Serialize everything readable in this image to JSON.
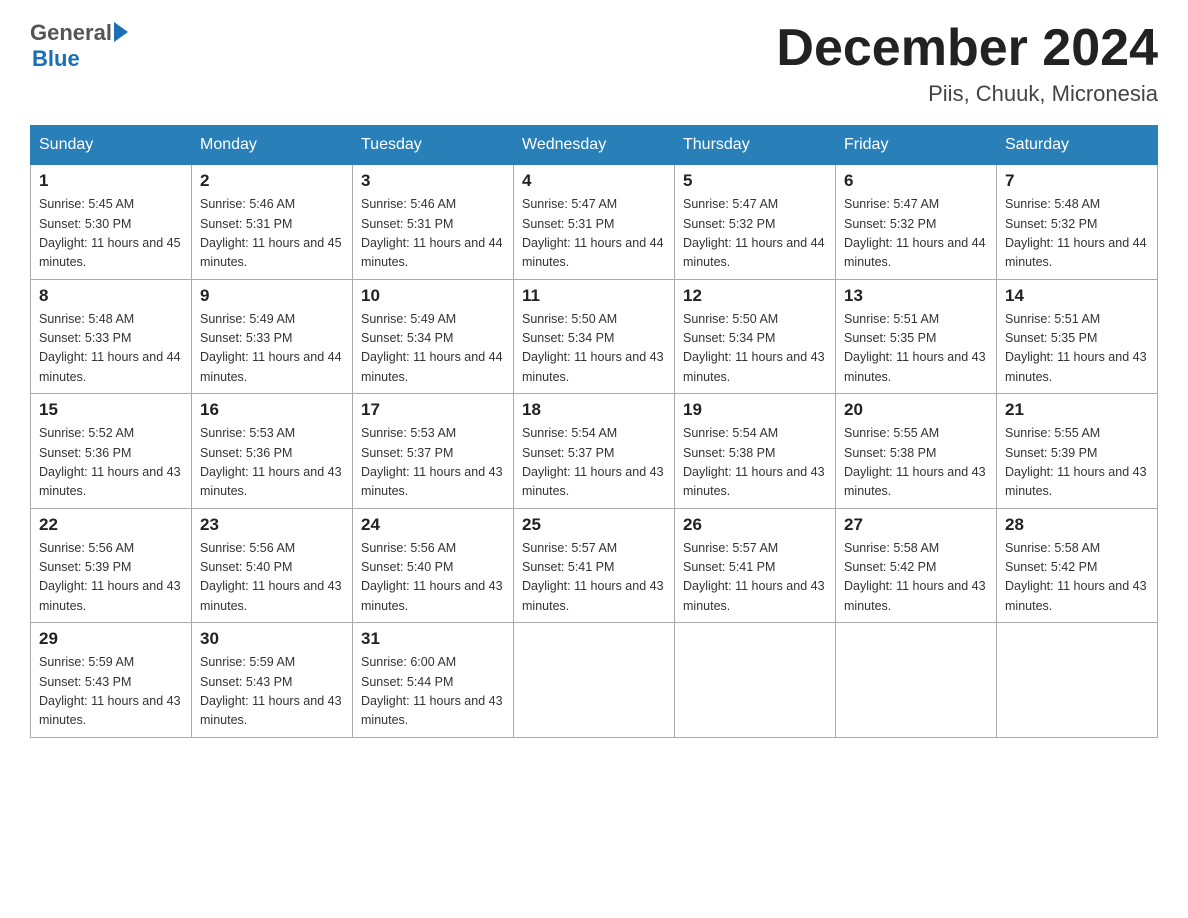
{
  "header": {
    "logo": {
      "general": "General",
      "blue": "Blue"
    },
    "title": "December 2024",
    "location": "Piis, Chuuk, Micronesia"
  },
  "days_of_week": [
    "Sunday",
    "Monday",
    "Tuesday",
    "Wednesday",
    "Thursday",
    "Friday",
    "Saturday"
  ],
  "weeks": [
    [
      {
        "day": "1",
        "sunrise": "5:45 AM",
        "sunset": "5:30 PM",
        "daylight": "11 hours and 45 minutes."
      },
      {
        "day": "2",
        "sunrise": "5:46 AM",
        "sunset": "5:31 PM",
        "daylight": "11 hours and 45 minutes."
      },
      {
        "day": "3",
        "sunrise": "5:46 AM",
        "sunset": "5:31 PM",
        "daylight": "11 hours and 44 minutes."
      },
      {
        "day": "4",
        "sunrise": "5:47 AM",
        "sunset": "5:31 PM",
        "daylight": "11 hours and 44 minutes."
      },
      {
        "day": "5",
        "sunrise": "5:47 AM",
        "sunset": "5:32 PM",
        "daylight": "11 hours and 44 minutes."
      },
      {
        "day": "6",
        "sunrise": "5:47 AM",
        "sunset": "5:32 PM",
        "daylight": "11 hours and 44 minutes."
      },
      {
        "day": "7",
        "sunrise": "5:48 AM",
        "sunset": "5:32 PM",
        "daylight": "11 hours and 44 minutes."
      }
    ],
    [
      {
        "day": "8",
        "sunrise": "5:48 AM",
        "sunset": "5:33 PM",
        "daylight": "11 hours and 44 minutes."
      },
      {
        "day": "9",
        "sunrise": "5:49 AM",
        "sunset": "5:33 PM",
        "daylight": "11 hours and 44 minutes."
      },
      {
        "day": "10",
        "sunrise": "5:49 AM",
        "sunset": "5:34 PM",
        "daylight": "11 hours and 44 minutes."
      },
      {
        "day": "11",
        "sunrise": "5:50 AM",
        "sunset": "5:34 PM",
        "daylight": "11 hours and 43 minutes."
      },
      {
        "day": "12",
        "sunrise": "5:50 AM",
        "sunset": "5:34 PM",
        "daylight": "11 hours and 43 minutes."
      },
      {
        "day": "13",
        "sunrise": "5:51 AM",
        "sunset": "5:35 PM",
        "daylight": "11 hours and 43 minutes."
      },
      {
        "day": "14",
        "sunrise": "5:51 AM",
        "sunset": "5:35 PM",
        "daylight": "11 hours and 43 minutes."
      }
    ],
    [
      {
        "day": "15",
        "sunrise": "5:52 AM",
        "sunset": "5:36 PM",
        "daylight": "11 hours and 43 minutes."
      },
      {
        "day": "16",
        "sunrise": "5:53 AM",
        "sunset": "5:36 PM",
        "daylight": "11 hours and 43 minutes."
      },
      {
        "day": "17",
        "sunrise": "5:53 AM",
        "sunset": "5:37 PM",
        "daylight": "11 hours and 43 minutes."
      },
      {
        "day": "18",
        "sunrise": "5:54 AM",
        "sunset": "5:37 PM",
        "daylight": "11 hours and 43 minutes."
      },
      {
        "day": "19",
        "sunrise": "5:54 AM",
        "sunset": "5:38 PM",
        "daylight": "11 hours and 43 minutes."
      },
      {
        "day": "20",
        "sunrise": "5:55 AM",
        "sunset": "5:38 PM",
        "daylight": "11 hours and 43 minutes."
      },
      {
        "day": "21",
        "sunrise": "5:55 AM",
        "sunset": "5:39 PM",
        "daylight": "11 hours and 43 minutes."
      }
    ],
    [
      {
        "day": "22",
        "sunrise": "5:56 AM",
        "sunset": "5:39 PM",
        "daylight": "11 hours and 43 minutes."
      },
      {
        "day": "23",
        "sunrise": "5:56 AM",
        "sunset": "5:40 PM",
        "daylight": "11 hours and 43 minutes."
      },
      {
        "day": "24",
        "sunrise": "5:56 AM",
        "sunset": "5:40 PM",
        "daylight": "11 hours and 43 minutes."
      },
      {
        "day": "25",
        "sunrise": "5:57 AM",
        "sunset": "5:41 PM",
        "daylight": "11 hours and 43 minutes."
      },
      {
        "day": "26",
        "sunrise": "5:57 AM",
        "sunset": "5:41 PM",
        "daylight": "11 hours and 43 minutes."
      },
      {
        "day": "27",
        "sunrise": "5:58 AM",
        "sunset": "5:42 PM",
        "daylight": "11 hours and 43 minutes."
      },
      {
        "day": "28",
        "sunrise": "5:58 AM",
        "sunset": "5:42 PM",
        "daylight": "11 hours and 43 minutes."
      }
    ],
    [
      {
        "day": "29",
        "sunrise": "5:59 AM",
        "sunset": "5:43 PM",
        "daylight": "11 hours and 43 minutes."
      },
      {
        "day": "30",
        "sunrise": "5:59 AM",
        "sunset": "5:43 PM",
        "daylight": "11 hours and 43 minutes."
      },
      {
        "day": "31",
        "sunrise": "6:00 AM",
        "sunset": "5:44 PM",
        "daylight": "11 hours and 43 minutes."
      },
      null,
      null,
      null,
      null
    ]
  ]
}
